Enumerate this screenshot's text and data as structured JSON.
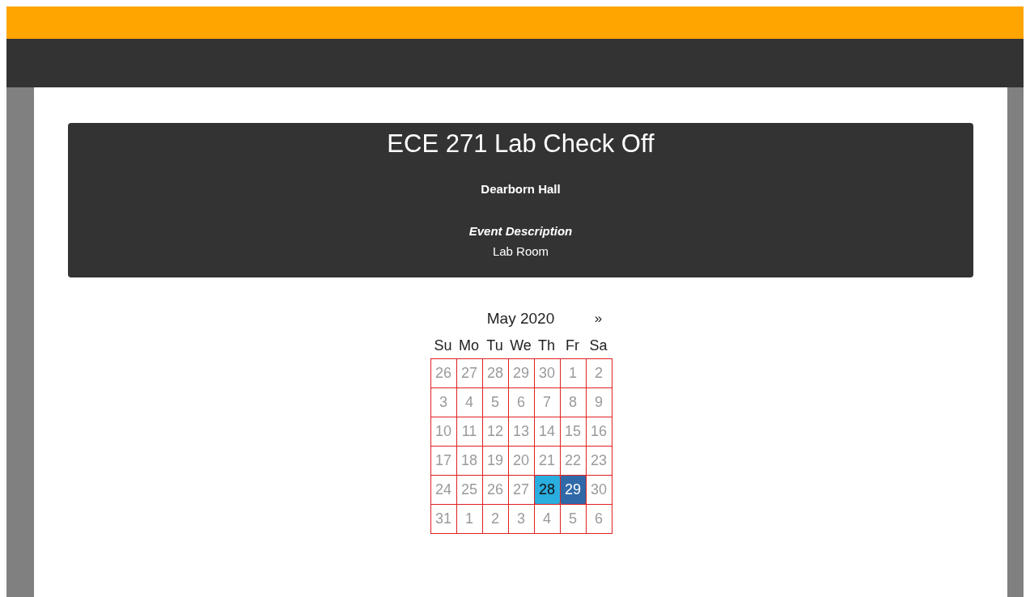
{
  "event": {
    "title": "ECE 271 Lab Check Off",
    "location": "Dearborn Hall",
    "description_heading": "Event Description",
    "description": "Lab Room"
  },
  "calendar": {
    "month": "May 2020",
    "next": "»",
    "weekdays": [
      "Su",
      "Mo",
      "Tu",
      "We",
      "Th",
      "Fr",
      "Sa"
    ],
    "weeks": [
      [
        {
          "label": "26",
          "disabled": true,
          "today": false,
          "selected": false
        },
        {
          "label": "27",
          "disabled": true,
          "today": false,
          "selected": false
        },
        {
          "label": "28",
          "disabled": true,
          "today": false,
          "selected": false
        },
        {
          "label": "29",
          "disabled": true,
          "today": false,
          "selected": false
        },
        {
          "label": "30",
          "disabled": true,
          "today": false,
          "selected": false
        },
        {
          "label": "1",
          "disabled": true,
          "today": false,
          "selected": false
        },
        {
          "label": "2",
          "disabled": true,
          "today": false,
          "selected": false
        }
      ],
      [
        {
          "label": "3",
          "disabled": true,
          "today": false,
          "selected": false
        },
        {
          "label": "4",
          "disabled": true,
          "today": false,
          "selected": false
        },
        {
          "label": "5",
          "disabled": true,
          "today": false,
          "selected": false
        },
        {
          "label": "6",
          "disabled": true,
          "today": false,
          "selected": false
        },
        {
          "label": "7",
          "disabled": true,
          "today": false,
          "selected": false
        },
        {
          "label": "8",
          "disabled": true,
          "today": false,
          "selected": false
        },
        {
          "label": "9",
          "disabled": true,
          "today": false,
          "selected": false
        }
      ],
      [
        {
          "label": "10",
          "disabled": true,
          "today": false,
          "selected": false
        },
        {
          "label": "11",
          "disabled": true,
          "today": false,
          "selected": false
        },
        {
          "label": "12",
          "disabled": true,
          "today": false,
          "selected": false
        },
        {
          "label": "13",
          "disabled": true,
          "today": false,
          "selected": false
        },
        {
          "label": "14",
          "disabled": true,
          "today": false,
          "selected": false
        },
        {
          "label": "15",
          "disabled": true,
          "today": false,
          "selected": false
        },
        {
          "label": "16",
          "disabled": true,
          "today": false,
          "selected": false
        }
      ],
      [
        {
          "label": "17",
          "disabled": true,
          "today": false,
          "selected": false
        },
        {
          "label": "18",
          "disabled": true,
          "today": false,
          "selected": false
        },
        {
          "label": "19",
          "disabled": true,
          "today": false,
          "selected": false
        },
        {
          "label": "20",
          "disabled": true,
          "today": false,
          "selected": false
        },
        {
          "label": "21",
          "disabled": true,
          "today": false,
          "selected": false
        },
        {
          "label": "22",
          "disabled": true,
          "today": false,
          "selected": false
        },
        {
          "label": "23",
          "disabled": true,
          "today": false,
          "selected": false
        }
      ],
      [
        {
          "label": "24",
          "disabled": true,
          "today": false,
          "selected": false
        },
        {
          "label": "25",
          "disabled": true,
          "today": false,
          "selected": false
        },
        {
          "label": "26",
          "disabled": true,
          "today": false,
          "selected": false
        },
        {
          "label": "27",
          "disabled": true,
          "today": false,
          "selected": false
        },
        {
          "label": "28",
          "disabled": false,
          "today": true,
          "selected": false
        },
        {
          "label": "29",
          "disabled": false,
          "today": false,
          "selected": true
        },
        {
          "label": "30",
          "disabled": true,
          "today": false,
          "selected": false
        }
      ],
      [
        {
          "label": "31",
          "disabled": true,
          "today": false,
          "selected": false
        },
        {
          "label": "1",
          "disabled": true,
          "today": false,
          "selected": false
        },
        {
          "label": "2",
          "disabled": true,
          "today": false,
          "selected": false
        },
        {
          "label": "3",
          "disabled": true,
          "today": false,
          "selected": false
        },
        {
          "label": "4",
          "disabled": true,
          "today": false,
          "selected": false
        },
        {
          "label": "5",
          "disabled": true,
          "today": false,
          "selected": false
        },
        {
          "label": "6",
          "disabled": true,
          "today": false,
          "selected": false
        }
      ]
    ]
  }
}
